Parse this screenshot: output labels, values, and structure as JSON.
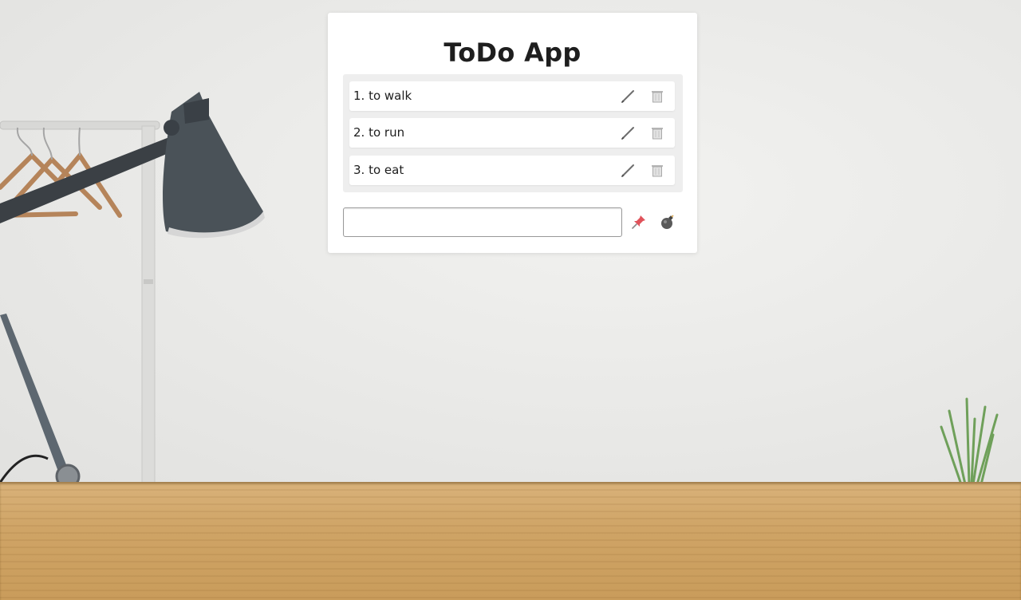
{
  "app": {
    "title": "ToDo App"
  },
  "todos": [
    {
      "number": "1.",
      "text": "to walk",
      "label": "1. to walk"
    },
    {
      "number": "2.",
      "text": "to run",
      "label": "2. to run"
    },
    {
      "number": "3.",
      "text": "to eat",
      "label": "3. to eat"
    }
  ],
  "new_todo": {
    "value": "",
    "placeholder": ""
  },
  "icons": {
    "edit": "pencil-icon",
    "delete": "trash-icon",
    "add": "pushpin-icon",
    "clear": "bomb-icon"
  },
  "colors": {
    "card_background": "#ffffff",
    "list_background": "#eeeeee",
    "title_text": "#1e1e1e",
    "pushpin": "#e0525a",
    "bomb": "#5a5a5a"
  }
}
